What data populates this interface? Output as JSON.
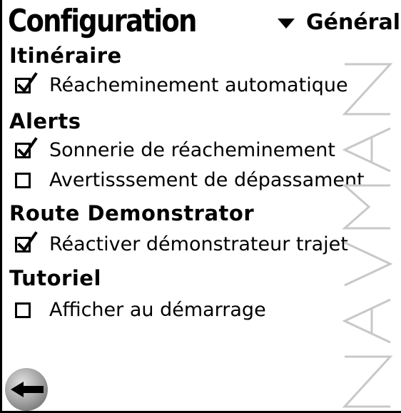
{
  "header": {
    "title": "Configuration",
    "category": "Général"
  },
  "sections": [
    {
      "heading": "Itinéraire",
      "options": [
        {
          "label": "Réacheminement automatique",
          "checked": true
        }
      ]
    },
    {
      "heading": "Alerts",
      "options": [
        {
          "label": "Sonnerie de réacheminement",
          "checked": true
        },
        {
          "label": "Avertisssement de dépassament",
          "checked": false
        }
      ]
    },
    {
      "heading": "Route Demonstrator",
      "options": [
        {
          "label": "Réactiver démonstrateur trajet",
          "checked": true
        }
      ]
    },
    {
      "heading": "Tutoriel",
      "options": [
        {
          "label": "Afficher au démarrage",
          "checked": false
        }
      ]
    }
  ],
  "brand": {
    "text": "NAVMAN"
  },
  "icons": {
    "category_dropdown": "triangle-down-icon",
    "back": "back-arrow-icon",
    "checked": "checkmark-icon"
  },
  "colors": {
    "background": "#ffffff",
    "text": "#000000",
    "watermark": "#c8c8c8",
    "button": "#8c8c8c"
  }
}
